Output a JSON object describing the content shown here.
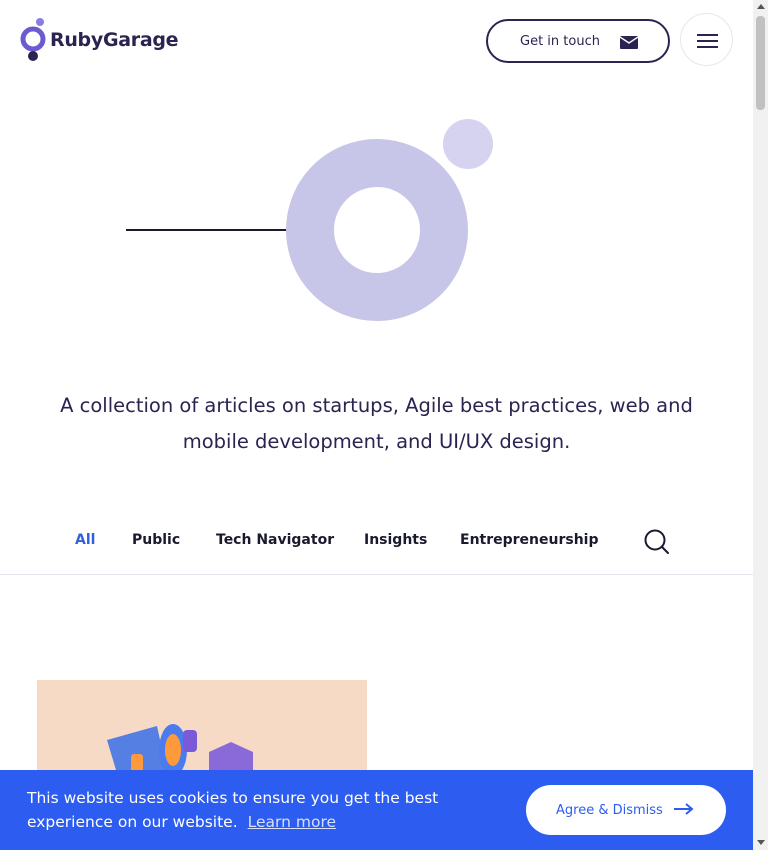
{
  "header": {
    "logo_text": "RubyGarage",
    "cta_label": "Get in touch",
    "cta_icon": "mail-icon",
    "menu_icon": "hamburger-icon"
  },
  "hero": {
    "tagline_line1": "A collection of articles on startups, Agile best practices, web and",
    "tagline_line2": "mobile development, and UI/UX design.",
    "colors": {
      "ring": "#c8c6e8",
      "dot": "#d5d3ef",
      "line": "#1a1a2e"
    }
  },
  "tabs": {
    "items": [
      {
        "label": "All",
        "active": true
      },
      {
        "label": "Public",
        "active": false
      },
      {
        "label": "Tech Navigator",
        "active": false
      },
      {
        "label": "Insights",
        "active": false
      },
      {
        "label": "Entrepreneurship",
        "active": false
      }
    ],
    "search_icon": "search-icon"
  },
  "cookie_banner": {
    "message": "This website uses cookies to ensure you get the best experience on our website.",
    "link_label": "Learn more",
    "button_label": "Agree & Dismiss",
    "background": "#2c5cf0"
  },
  "colors": {
    "brand_dark": "#2b2350",
    "accent_blue": "#3060e0",
    "logo_purple": "#6b5bd0"
  }
}
